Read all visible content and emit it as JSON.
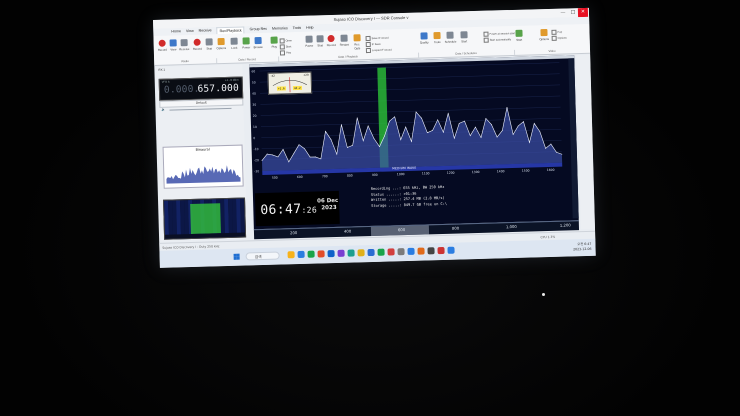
{
  "window": {
    "title": "Sujaso ICO Discovery I — SDR Console v",
    "controls": {
      "minimize": "—",
      "maximize": "□",
      "close": "✕"
    }
  },
  "menu": [
    "Home",
    "View",
    "Receive",
    "Rec/Playback",
    "Group Rec",
    "Memories",
    "Tools",
    "Help"
  ],
  "ribbon": {
    "buttons": [
      {
        "label": "Record",
        "icon": "record-icon"
      },
      {
        "label": "View",
        "icon": "view-icon"
      },
      {
        "label": "Receive",
        "icon": "receive-icon"
      },
      {
        "label": "Record",
        "icon": "record-icon"
      },
      {
        "label": "Stop",
        "icon": "stop-icon"
      },
      {
        "label": "Options",
        "icon": "options-icon"
      },
      {
        "label": "Look",
        "icon": "look-icon"
      },
      {
        "label": "Power",
        "icon": "power-icon"
      },
      {
        "label": "Browse",
        "icon": "browse-icon"
      },
      {
        "label": "Play",
        "icon": "play-icon"
      },
      {
        "label": "Pause",
        "icon": "pause-icon"
      },
      {
        "label": "Stop",
        "icon": "stop-icon"
      },
      {
        "label": "Record",
        "icon": "record-icon"
      },
      {
        "label": "Restart",
        "icon": "restart-icon"
      },
      {
        "label": "Rec. Opts",
        "icon": "rec-options-icon"
      },
      {
        "label": "Quality",
        "icon": "quality-icon"
      },
      {
        "label": "Tools",
        "icon": "tools-icon"
      },
      {
        "label": "Schedule",
        "icon": "schedule-icon"
      },
      {
        "label": "Start",
        "icon": "start-icon"
      },
      {
        "label": "Start",
        "icon": "start-icon"
      },
      {
        "label": "Options",
        "icon": "options-icon"
      }
    ],
    "small_items": [
      "Open",
      "Start",
      "Play",
      "Save IF record",
      "IF Save",
      "Looped IF record",
      "Power at session start",
      "Start automatically",
      "Pop",
      "Options"
    ],
    "groups": [
      "Radio",
      "Data / Record",
      "Data / Playback",
      "Data / Schedules",
      "Video"
    ]
  },
  "radio": {
    "header": "RX 1",
    "vfo_label": "VFO A",
    "readout": "+1 -9 dBm",
    "freq_dim": "0.000.",
    "freq_bright": "657.000",
    "preset": "Default",
    "mini_label": "Binaural",
    "mini_wf_label": "Waterfall"
  },
  "spectrum": {
    "band_label": "MEDIUM WAVE",
    "db_ticks": [
      "60",
      "50",
      "40",
      "30",
      "20",
      "10",
      "0",
      "-10",
      "-20",
      "-30"
    ],
    "freq_ticks": [
      "500",
      "600",
      "700",
      "800",
      "900",
      "1000",
      "1100",
      "1200",
      "1300",
      "1400",
      "1500",
      "1600"
    ],
    "meter": {
      "left": "-42",
      "right": "+20",
      "dig1": "+1.6",
      "dig2": "44.2"
    }
  },
  "clock": {
    "time": "06:47",
    "seconds": ":26",
    "day": "06 Dec",
    "year": "2023"
  },
  "recording": [
    {
      "key": "Recording ...",
      "val": ": 655 kHz, BW 250 kHz"
    },
    {
      "key": "Status ......",
      "val": ": +01:36"
    },
    {
      "key": "Written .....",
      "val": ": 257.4 MB (2.8 MB/s)"
    },
    {
      "key": "Storage .....",
      "val": ": 849.7 GB free on C:\\"
    }
  ],
  "freqbar": [
    "200",
    "400",
    "600",
    "800",
    "1,000",
    "1,200"
  ],
  "statusbar": {
    "left": "Sujaso ICO Discovery I - Duty 250 kHz",
    "right": "CPU 1.3%"
  },
  "taskbar": {
    "search": "검색",
    "time": "오전 6:47",
    "date": "2023-12-06"
  },
  "chart_data": {
    "type": "line",
    "title": "",
    "xlabel": "",
    "ylabel": "",
    "x": [
      480,
      500,
      520,
      540,
      560,
      580,
      600,
      620,
      640,
      660,
      680,
      700,
      720,
      740,
      760,
      780,
      800,
      820,
      840,
      860,
      880,
      900,
      920,
      940,
      960,
      980,
      1000,
      1020,
      1040,
      1060,
      1080,
      1100,
      1120,
      1140,
      1160,
      1180,
      1200,
      1220,
      1240,
      1260,
      1280,
      1300,
      1320,
      1340,
      1360,
      1380,
      1400,
      1420,
      1440,
      1460,
      1480,
      1500,
      1520,
      1540,
      1560,
      1580,
      1600
    ],
    "values": [
      -20,
      -14,
      -15,
      -17,
      -10,
      -22,
      -14,
      -6,
      -10,
      -18,
      -18,
      -20,
      6,
      -2,
      -16,
      12,
      -10,
      -8,
      18,
      -4,
      10,
      -2,
      -10,
      0,
      14,
      18,
      -4,
      8,
      -6,
      22,
      16,
      2,
      4,
      14,
      2,
      20,
      -4,
      10,
      12,
      -2,
      6,
      -4,
      14,
      8,
      -4,
      2,
      24,
      -2,
      6,
      10,
      -10,
      8,
      0,
      -16,
      -12,
      -20,
      -22
    ],
    "ylim": [
      -30,
      65
    ],
    "highlight_band": [
      920,
      952
    ],
    "grid": true
  }
}
